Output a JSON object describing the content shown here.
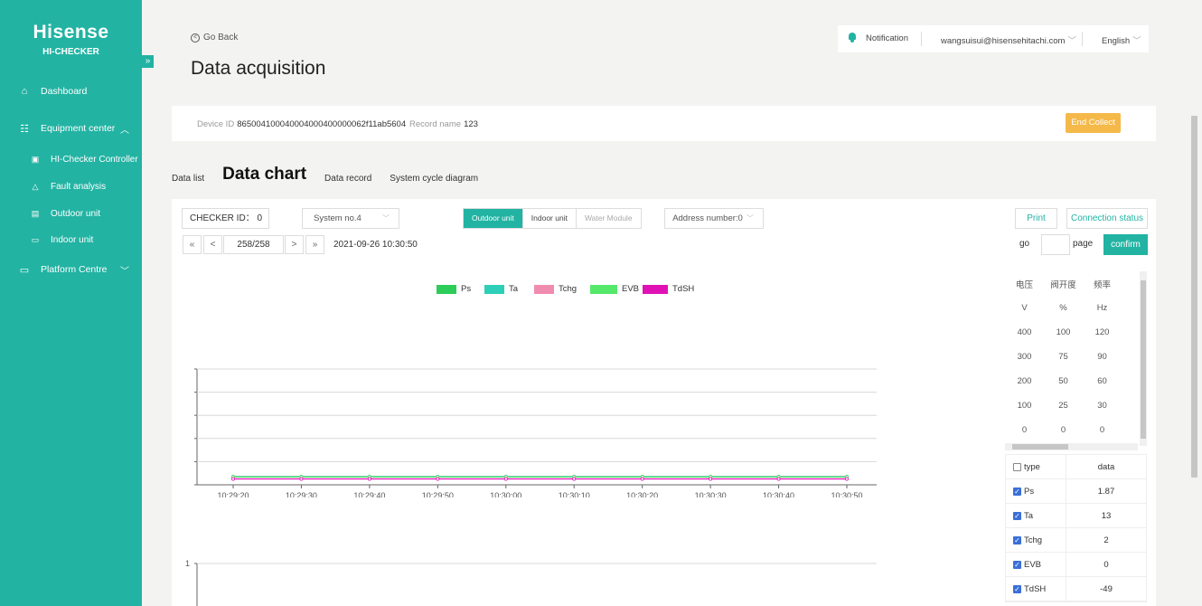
{
  "brand": {
    "logo": "Hisense",
    "subtitle": "HI-CHECKER"
  },
  "sidebar": {
    "items": [
      {
        "label": "Dashboard",
        "icon": "home-icon"
      },
      {
        "label": "Equipment center",
        "icon": "list-icon"
      },
      {
        "label": "HI-Checker Controller",
        "icon": "controller-icon"
      },
      {
        "label": "Fault analysis",
        "icon": "warning-icon"
      },
      {
        "label": "Outdoor unit",
        "icon": "outdoor-unit-icon"
      },
      {
        "label": "Indoor unit",
        "icon": "indoor-unit-icon"
      },
      {
        "label": "Platform Centre",
        "icon": "monitor-icon"
      }
    ]
  },
  "header": {
    "notification": "Notification",
    "user": "wangsuisui@hisensehitachi.com",
    "language": "English"
  },
  "page": {
    "back": "Go Back",
    "title": "Data acquisition"
  },
  "device": {
    "id_label": "Device ID",
    "id_value": "865004100040004000400000062f11ab5604",
    "record_label": "Record name",
    "record_value": "123",
    "end_button": "End Collect"
  },
  "tabs": [
    "Data list",
    "Data chart",
    "Data record",
    "System cycle diagram"
  ],
  "controls": {
    "checker_id": "CHECKER ID： 0",
    "system": "System no.4",
    "unit_tabs": [
      "Outdoor unit",
      "Indoor unit",
      "Water Module"
    ],
    "address": "Address number:0",
    "print": "Print",
    "connection": "Connection status"
  },
  "pager": {
    "first": "«",
    "prev": "<",
    "current": "258/258",
    "next": ">",
    "last": "»",
    "timestamp": "2021-09-26 10:30:50",
    "go": "go",
    "page": "page",
    "confirm": "confirm"
  },
  "legend": [
    {
      "name": "Ps",
      "color": "#2ecc59"
    },
    {
      "name": "Ta",
      "color": "#2ecfb8"
    },
    {
      "name": "Tchg",
      "color": "#f08bb0"
    },
    {
      "name": "EVB",
      "color": "#55e86b"
    },
    {
      "name": "TdSH",
      "color": "#e012b5"
    }
  ],
  "axis_table": {
    "headers": [
      "电压",
      "阀开度",
      "频率"
    ],
    "units": [
      "V",
      "%",
      "Hz"
    ],
    "rows": [
      [
        "400",
        "100",
        "120"
      ],
      [
        "300",
        "75",
        "90"
      ],
      [
        "200",
        "50",
        "60"
      ],
      [
        "100",
        "25",
        "30"
      ],
      [
        "0",
        "0",
        "0"
      ]
    ]
  },
  "data_table": {
    "header_type": "type",
    "header_data": "data",
    "rows": [
      {
        "type": "Ps",
        "value": "1.87"
      },
      {
        "type": "Ta",
        "value": "13"
      },
      {
        "type": "Tchg",
        "value": "2"
      },
      {
        "type": "EVB",
        "value": "0"
      },
      {
        "type": "TdSH",
        "value": "-49"
      }
    ]
  },
  "chart_data": [
    {
      "type": "line",
      "x": [
        "10:29:20",
        "10:29:30",
        "10:29:40",
        "10:29:50",
        "10:30:00",
        "10:30:10",
        "10:30:20",
        "10:30:30",
        "10:30:40",
        "10:30:50"
      ],
      "series": [
        {
          "name": "Ps",
          "values": [
            1.87,
            1.87,
            1.87,
            1.87,
            1.87,
            1.87,
            1.87,
            1.87,
            1.87,
            1.87
          ]
        },
        {
          "name": "Ta",
          "values": [
            13,
            13,
            13,
            13,
            13,
            13,
            13,
            13,
            13,
            13
          ]
        },
        {
          "name": "Tchg",
          "values": [
            2,
            2,
            2,
            2,
            2,
            2,
            2,
            2,
            2,
            2
          ]
        },
        {
          "name": "EVB",
          "values": [
            0,
            0,
            0,
            0,
            0,
            0,
            0,
            0,
            0,
            0
          ]
        },
        {
          "name": "TdSH",
          "values": [
            -49,
            -49,
            -49,
            -49,
            -49,
            -49,
            -49,
            -49,
            -49,
            -49
          ]
        }
      ],
      "grid": true
    },
    {
      "type": "line",
      "y_ticks": [
        "1"
      ],
      "series": []
    }
  ]
}
